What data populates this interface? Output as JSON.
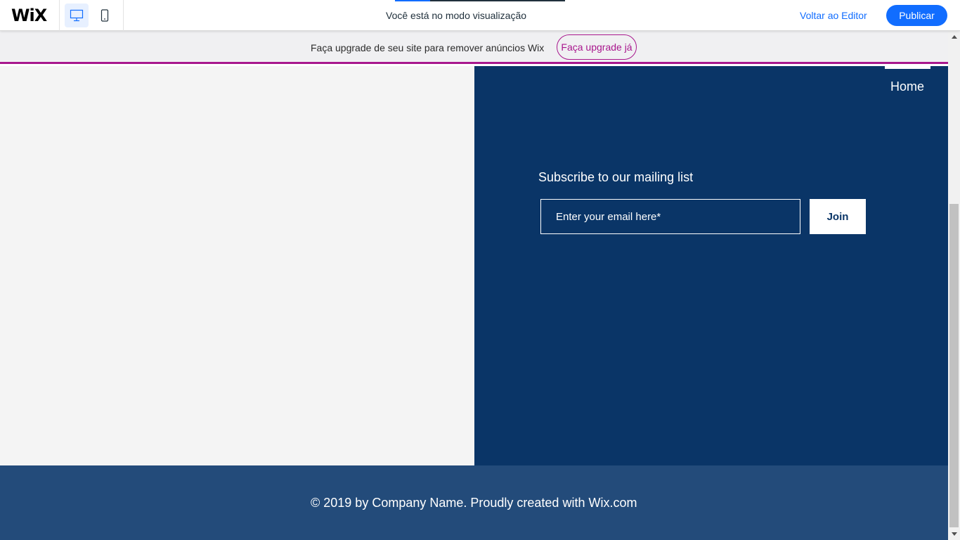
{
  "topbar": {
    "logo": "WiX",
    "preview_text": "Você está no modo visualização",
    "back_to_editor": "Voltar ao Editor",
    "publish": "Publicar",
    "devices": [
      {
        "icon": "desktop-icon",
        "selected": true
      },
      {
        "icon": "mobile-icon",
        "selected": false
      }
    ]
  },
  "banner": {
    "text": "Faça upgrade de seu site para remover anúncios Wix",
    "button": "Faça upgrade já"
  },
  "site": {
    "nav": {
      "home": "Home"
    },
    "subscribe": {
      "title": "Subscribe to our mailing list",
      "email_placeholder": "Enter your email here*",
      "email_value": "",
      "join": "Join"
    },
    "footer": {
      "copyright": "© 2019 by Company Name. Proudly created with Wix.com"
    }
  },
  "colors": {
    "accent_blue": "#116dff",
    "banner_accent": "#a8178d",
    "panel_navy": "#0a3567",
    "footer_blue": "#234b7a",
    "panel_light": "#f4f4f4"
  }
}
